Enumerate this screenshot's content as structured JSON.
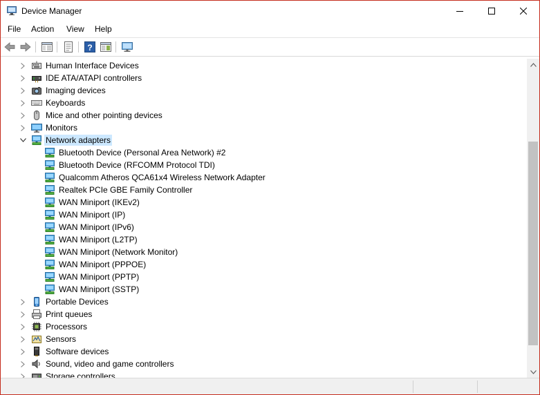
{
  "window": {
    "title": "Device Manager",
    "accent_border": "#c42b1c",
    "selection_color": "#cce8ff"
  },
  "title_controls": {
    "minimize_icon": "minimize-icon",
    "maximize_icon": "maximize-icon",
    "close_icon": "close-icon"
  },
  "menu": {
    "items": [
      {
        "label": "File"
      },
      {
        "label": "Action"
      },
      {
        "label": "View"
      },
      {
        "label": "Help"
      }
    ]
  },
  "toolbar": {
    "buttons": [
      {
        "icon": "back-arrow-icon"
      },
      {
        "icon": "forward-arrow-icon"
      },
      {
        "icon": "show-hide-console-tree-icon"
      },
      {
        "icon": "properties-icon"
      },
      {
        "icon": "help-icon"
      },
      {
        "icon": "action-pane-icon"
      },
      {
        "icon": "monitor-icon"
      }
    ]
  },
  "tree": {
    "nodes": [
      {
        "label": "Human Interface Devices",
        "icon": "hid-icon",
        "level": 0,
        "expanded": false
      },
      {
        "label": "IDE ATA/ATAPI controllers",
        "icon": "ide-controller-icon",
        "level": 0,
        "expanded": false
      },
      {
        "label": "Imaging devices",
        "icon": "camera-icon",
        "level": 0,
        "expanded": false
      },
      {
        "label": "Keyboards",
        "icon": "keyboard-icon",
        "level": 0,
        "expanded": false
      },
      {
        "label": "Mice and other pointing devices",
        "icon": "mouse-icon",
        "level": 0,
        "expanded": false
      },
      {
        "label": "Monitors",
        "icon": "monitor-icon",
        "level": 0,
        "expanded": false
      },
      {
        "label": "Network adapters",
        "icon": "network-adapter-icon",
        "level": 0,
        "expanded": true,
        "selected": true
      },
      {
        "label": "Bluetooth Device (Personal Area Network) #2",
        "icon": "network-adapter-icon",
        "level": 1
      },
      {
        "label": "Bluetooth Device (RFCOMM Protocol TDI)",
        "icon": "network-adapter-icon",
        "level": 1
      },
      {
        "label": "Qualcomm Atheros QCA61x4 Wireless Network Adapter",
        "icon": "network-adapter-icon",
        "level": 1
      },
      {
        "label": "Realtek PCIe GBE Family Controller",
        "icon": "network-adapter-icon",
        "level": 1
      },
      {
        "label": "WAN Miniport (IKEv2)",
        "icon": "network-adapter-icon",
        "level": 1
      },
      {
        "label": "WAN Miniport (IP)",
        "icon": "network-adapter-icon",
        "level": 1
      },
      {
        "label": "WAN Miniport (IPv6)",
        "icon": "network-adapter-icon",
        "level": 1
      },
      {
        "label": "WAN Miniport (L2TP)",
        "icon": "network-adapter-icon",
        "level": 1
      },
      {
        "label": "WAN Miniport (Network Monitor)",
        "icon": "network-adapter-icon",
        "level": 1
      },
      {
        "label": "WAN Miniport (PPPOE)",
        "icon": "network-adapter-icon",
        "level": 1
      },
      {
        "label": "WAN Miniport (PPTP)",
        "icon": "network-adapter-icon",
        "level": 1
      },
      {
        "label": "WAN Miniport (SSTP)",
        "icon": "network-adapter-icon",
        "level": 1
      },
      {
        "label": "Portable Devices",
        "icon": "portable-device-icon",
        "level": 0,
        "expanded": false
      },
      {
        "label": "Print queues",
        "icon": "printer-icon",
        "level": 0,
        "expanded": false
      },
      {
        "label": "Processors",
        "icon": "processor-icon",
        "level": 0,
        "expanded": false
      },
      {
        "label": "Sensors",
        "icon": "sensor-icon",
        "level": 0,
        "expanded": false
      },
      {
        "label": "Software devices",
        "icon": "software-device-icon",
        "level": 0,
        "expanded": false
      },
      {
        "label": "Sound, video and game controllers",
        "icon": "speaker-icon",
        "level": 0,
        "expanded": false
      },
      {
        "label": "Storage controllers",
        "icon": "storage-controller-icon",
        "level": 0,
        "expanded": false
      }
    ]
  },
  "scrollbar": {
    "position_fraction": 0.24,
    "visible_fraction": 0.69
  }
}
